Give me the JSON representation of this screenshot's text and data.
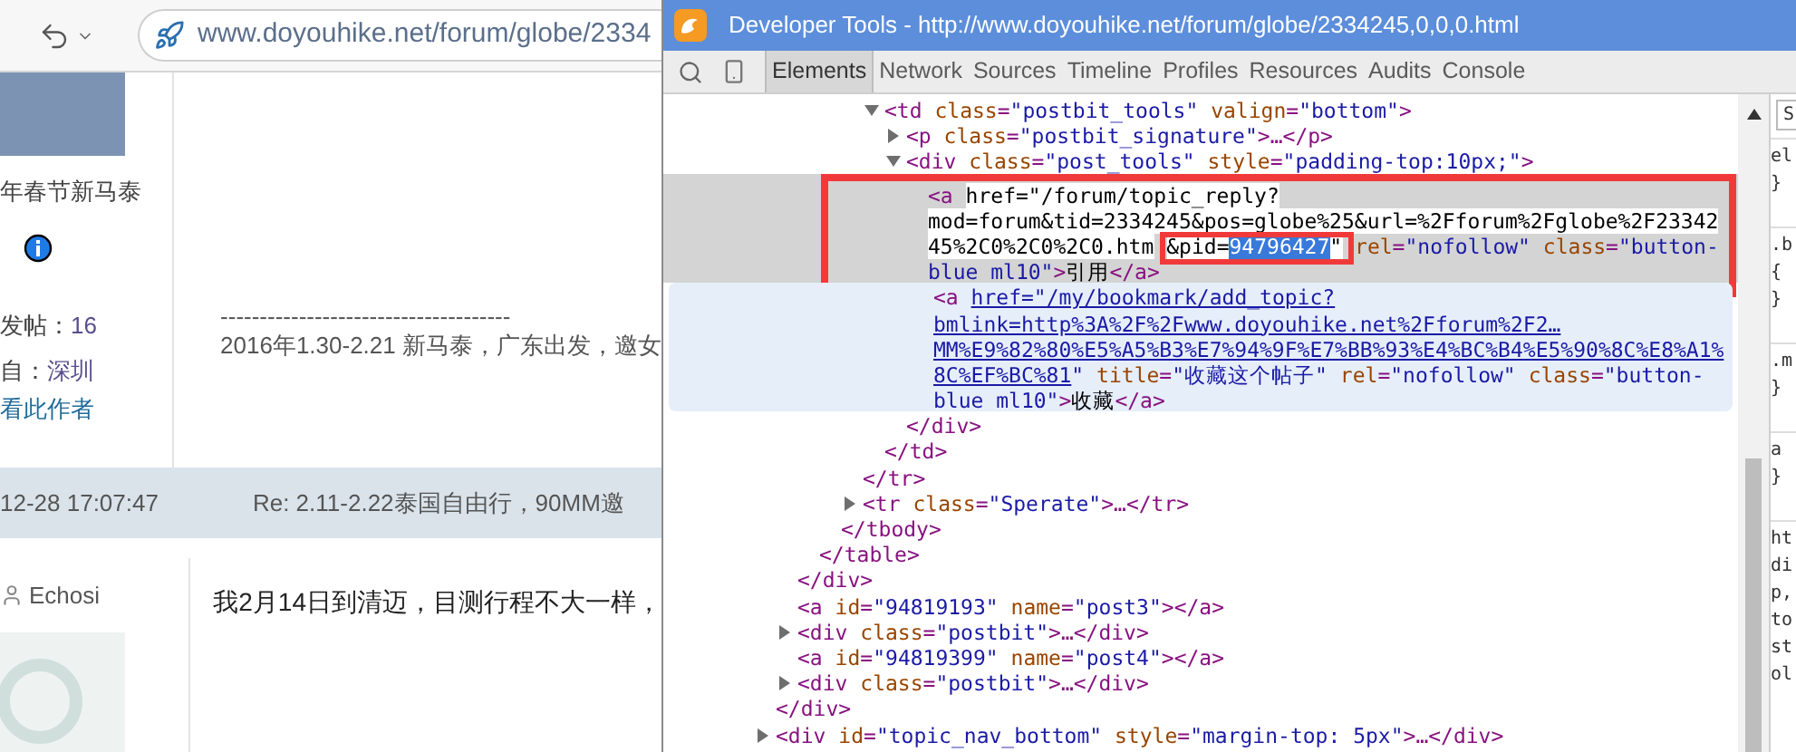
{
  "browser": {
    "url": "www.doyouhike.net/forum/globe/2334"
  },
  "page": {
    "author_panel": {
      "title_fragment": "年春节新马泰",
      "stats": [
        {
          "label": "发帖：",
          "value": "16"
        },
        {
          "label": "自：",
          "value": "深圳"
        }
      ],
      "link": "看此作者"
    },
    "post_body": {
      "rule": "-------------------------------------",
      "signature": "2016年1.30-2.21 新马泰，广东出发，邀女"
    },
    "reply_header": {
      "time": "12-28 17:07:47",
      "title": "Re: 2.11-2.22泰国自由行，90MM邀"
    },
    "reply": {
      "author": "Echosi",
      "text": "我2月14日到清迈，目测行程不大一样，"
    }
  },
  "devtools": {
    "title": "Developer Tools - http://www.doyouhike.net/forum/globe/2334245,0,0,0.html",
    "tabs": [
      {
        "label": "Elements",
        "selected": true
      },
      {
        "label": "Network",
        "selected": false
      },
      {
        "label": "Sources",
        "selected": false
      },
      {
        "label": "Timeline",
        "selected": false
      },
      {
        "label": "Profiles",
        "selected": false
      },
      {
        "label": "Resources",
        "selected": false
      },
      {
        "label": "Audits",
        "selected": false
      },
      {
        "label": "Console",
        "selected": false
      }
    ],
    "tree": [
      {
        "close": [
          {
            "kind": "tag",
            "text": "</div>"
          }
        ],
        "children": [
          {
            "close": [
              {
                "kind": "tag",
                "text": "</div>"
              }
            ],
            "children": [
              {
                "close": [
                  {
                    "kind": "tag",
                    "text": "</table>"
                  }
                ],
                "children": [
                  {
                    "close": [
                      {
                        "kind": "tag",
                        "text": "</tbody>"
                      }
                    ],
                    "children": [
                      {
                        "close": [
                          {
                            "kind": "tag",
                            "text": "</tr>"
                          }
                        ],
                        "children": [
                          {
                            "open": [
                              [
                                {
                                  "kind": "tag",
                                  "text": "<td"
                                },
                                {
                                  "kind": "attr",
                                  "text": "class"
                                },
                                {
                                  "kind": "tag",
                                  "text": "="
                                },
                                {
                                  "kind": "val",
                                  "text": "\"postbit_tools\""
                                },
                                {
                                  "kind": "attr",
                                  "text": "valign"
                                },
                                {
                                  "kind": "tag",
                                  "text": "="
                                },
                                {
                                  "kind": "val",
                                  "text": "\"bottom\""
                                },
                                {
                                  "kind": "tag",
                                  "text": ">"
                                }
                              ]
                            ],
                            "expanded": true,
                            "close": [
                              {
                                "kind": "tag",
                                "text": "</td>"
                              }
                            ],
                            "children": [
                              {
                                "open": [
                                  [
                                    {
                                      "kind": "tag",
                                      "text": "<p"
                                    },
                                    {
                                      "kind": "attr",
                                      "text": "class"
                                    },
                                    {
                                      "kind": "tag",
                                      "text": "="
                                    },
                                    {
                                      "kind": "val",
                                      "text": "\"postbit_signature\""
                                    },
                                    {
                                      "kind": "tag",
                                      "text": ">…</p>"
                                    }
                                  ]
                                ],
                                "expanded": false
                              },
                              {
                                "open": [
                                  [
                                    {
                                      "kind": "tag",
                                      "text": "<div"
                                    },
                                    {
                                      "kind": "attr",
                                      "text": "class"
                                    },
                                    {
                                      "kind": "tag",
                                      "text": "="
                                    },
                                    {
                                      "kind": "val",
                                      "text": "\"post_tools\""
                                    },
                                    {
                                      "kind": "attr",
                                      "text": "style"
                                    },
                                    {
                                      "kind": "tag",
                                      "text": "="
                                    },
                                    {
                                      "kind": "val",
                                      "text": "\"padding-top:10px;\""
                                    },
                                    {
                                      "kind": "tag",
                                      "text": ">"
                                    }
                                  ]
                                ],
                                "expanded": true,
                                "close": [
                                  {
                                    "kind": "tag",
                                    "text": "</div>"
                                  }
                                ],
                                "children": [
                                  {
                                    "selected": true,
                                    "framed": true,
                                    "open": [
                                      [
                                        {
                                          "kind": "tag",
                                          "text": "<a"
                                        },
                                        {
                                          "kind": "edit",
                                          "text": "href=\"/forum/topic_reply?"
                                        }
                                      ],
                                      [
                                        {
                                          "kind": "edit",
                                          "text": "mod=forum&tid=2334245&pos=globe%25&url=%2Fforum%2Fglobe%2F23342"
                                        }
                                      ],
                                      [
                                        {
                                          "kind": "edit",
                                          "text": "45%2C0%2C0%2C0.htm"
                                        },
                                        {
                                          "kind": "frame",
                                          "parts": [
                                            {
                                              "kind": "edit",
                                              "text": "&pid="
                                            },
                                            {
                                              "kind": "sel",
                                              "text": "94796427"
                                            },
                                            {
                                              "kind": "edit",
                                              "text": "\""
                                            }
                                          ]
                                        },
                                        {
                                          "kind": "attr",
                                          "text": "rel"
                                        },
                                        {
                                          "kind": "tag",
                                          "text": "="
                                        },
                                        {
                                          "kind": "val",
                                          "text": "\"nofollow\""
                                        },
                                        {
                                          "kind": "attr",
                                          "text": "class"
                                        },
                                        {
                                          "kind": "tag",
                                          "text": "="
                                        },
                                        {
                                          "kind": "val",
                                          "text": "\"button-"
                                        }
                                      ],
                                      [
                                        {
                                          "kind": "val",
                                          "text": "blue ml10\""
                                        },
                                        {
                                          "kind": "tag",
                                          "text": ">"
                                        },
                                        {
                                          "kind": "text",
                                          "text": "引用"
                                        },
                                        {
                                          "kind": "tag",
                                          "text": "</a>"
                                        }
                                      ]
                                    ]
                                  },
                                  {
                                    "hovered": true,
                                    "open": [
                                      [
                                        {
                                          "kind": "tag",
                                          "text": "<a"
                                        },
                                        {
                                          "kind": "link",
                                          "text": "href=\"/my/bookmark/add_topic?"
                                        }
                                      ],
                                      [
                                        {
                                          "kind": "link",
                                          "text": "bmlink=http%3A%2F%2Fwww.doyouhike.net%2Fforum%2F2…"
                                        }
                                      ],
                                      [
                                        {
                                          "kind": "link",
                                          "text": "MM%E9%82%80%E5%A5%B3%E7%94%9F%E7%BB%93%E4%BC%B4%E5%90%8C%E8%A1%"
                                        }
                                      ],
                                      [
                                        {
                                          "kind": "link",
                                          "text": "8C%EF%BC%81"
                                        },
                                        {
                                          "kind": "val",
                                          "text": "\""
                                        },
                                        {
                                          "kind": "attr",
                                          "text": "title"
                                        },
                                        {
                                          "kind": "tag",
                                          "text": "="
                                        },
                                        {
                                          "kind": "val",
                                          "text": "\"收藏这个帖子\""
                                        },
                                        {
                                          "kind": "attr",
                                          "text": "rel"
                                        },
                                        {
                                          "kind": "tag",
                                          "text": "="
                                        },
                                        {
                                          "kind": "val",
                                          "text": "\"nofollow\""
                                        },
                                        {
                                          "kind": "attr",
                                          "text": "class"
                                        },
                                        {
                                          "kind": "tag",
                                          "text": "="
                                        },
                                        {
                                          "kind": "val",
                                          "text": "\"button-"
                                        }
                                      ],
                                      [
                                        {
                                          "kind": "val",
                                          "text": "blue ml10\""
                                        },
                                        {
                                          "kind": "tag",
                                          "text": ">"
                                        },
                                        {
                                          "kind": "text",
                                          "text": "收藏"
                                        },
                                        {
                                          "kind": "tag",
                                          "text": "</a>"
                                        }
                                      ]
                                    ]
                                  }
                                ]
                              }
                            ]
                          }
                        ]
                      },
                      {
                        "open": [
                          [
                            {
                              "kind": "tag",
                              "text": "<tr"
                            },
                            {
                              "kind": "attr",
                              "text": "class"
                            },
                            {
                              "kind": "tag",
                              "text": "="
                            },
                            {
                              "kind": "val",
                              "text": "\"Sperate\""
                            },
                            {
                              "kind": "tag",
                              "text": ">…</tr>"
                            }
                          ]
                        ],
                        "expanded": false
                      }
                    ]
                  }
                ]
              }
            ]
          },
          {
            "open": [
              [
                {
                  "kind": "tag",
                  "text": "<a"
                },
                {
                  "kind": "attr",
                  "text": "id"
                },
                {
                  "kind": "tag",
                  "text": "="
                },
                {
                  "kind": "val",
                  "text": "\"94819193\""
                },
                {
                  "kind": "attr",
                  "text": "name"
                },
                {
                  "kind": "tag",
                  "text": "="
                },
                {
                  "kind": "val",
                  "text": "\"post3\""
                },
                {
                  "kind": "tag",
                  "text": "></a>"
                }
              ]
            ]
          },
          {
            "open": [
              [
                {
                  "kind": "tag",
                  "text": "<div"
                },
                {
                  "kind": "attr",
                  "text": "class"
                },
                {
                  "kind": "tag",
                  "text": "="
                },
                {
                  "kind": "val",
                  "text": "\"postbit\""
                },
                {
                  "kind": "tag",
                  "text": ">…</div>"
                }
              ]
            ],
            "expanded": false
          },
          {
            "open": [
              [
                {
                  "kind": "tag",
                  "text": "<a"
                },
                {
                  "kind": "attr",
                  "text": "id"
                },
                {
                  "kind": "tag",
                  "text": "="
                },
                {
                  "kind": "val",
                  "text": "\"94819399\""
                },
                {
                  "kind": "attr",
                  "text": "name"
                },
                {
                  "kind": "tag",
                  "text": "="
                },
                {
                  "kind": "val",
                  "text": "\"post4\""
                },
                {
                  "kind": "tag",
                  "text": "></a>"
                }
              ]
            ]
          },
          {
            "open": [
              [
                {
                  "kind": "tag",
                  "text": "<div"
                },
                {
                  "kind": "attr",
                  "text": "class"
                },
                {
                  "kind": "tag",
                  "text": "="
                },
                {
                  "kind": "val",
                  "text": "\"postbit\""
                },
                {
                  "kind": "tag",
                  "text": ">…</div>"
                }
              ]
            ],
            "expanded": false
          }
        ]
      },
      {
        "open": [
          [
            {
              "kind": "tag",
              "text": "<div"
            },
            {
              "kind": "attr",
              "text": "id"
            },
            {
              "kind": "tag",
              "text": "="
            },
            {
              "kind": "val",
              "text": "\"topic_nav_bottom\""
            },
            {
              "kind": "attr",
              "text": "style"
            },
            {
              "kind": "tag",
              "text": "="
            },
            {
              "kind": "val",
              "text": "\"margin-top: 5px\""
            },
            {
              "kind": "tag",
              "text": ">…</div>"
            }
          ]
        ],
        "expanded": false
      }
    ],
    "styles_panel": {
      "tab": "S",
      "groups": [
        [
          "el",
          "}"
        ],
        [
          ".b",
          "{",
          "}"
        ],
        [
          ".m",
          "}"
        ],
        [
          "a",
          "}"
        ],
        [
          "ht",
          "di",
          "p,",
          "to",
          "st",
          "ol"
        ]
      ]
    }
  }
}
